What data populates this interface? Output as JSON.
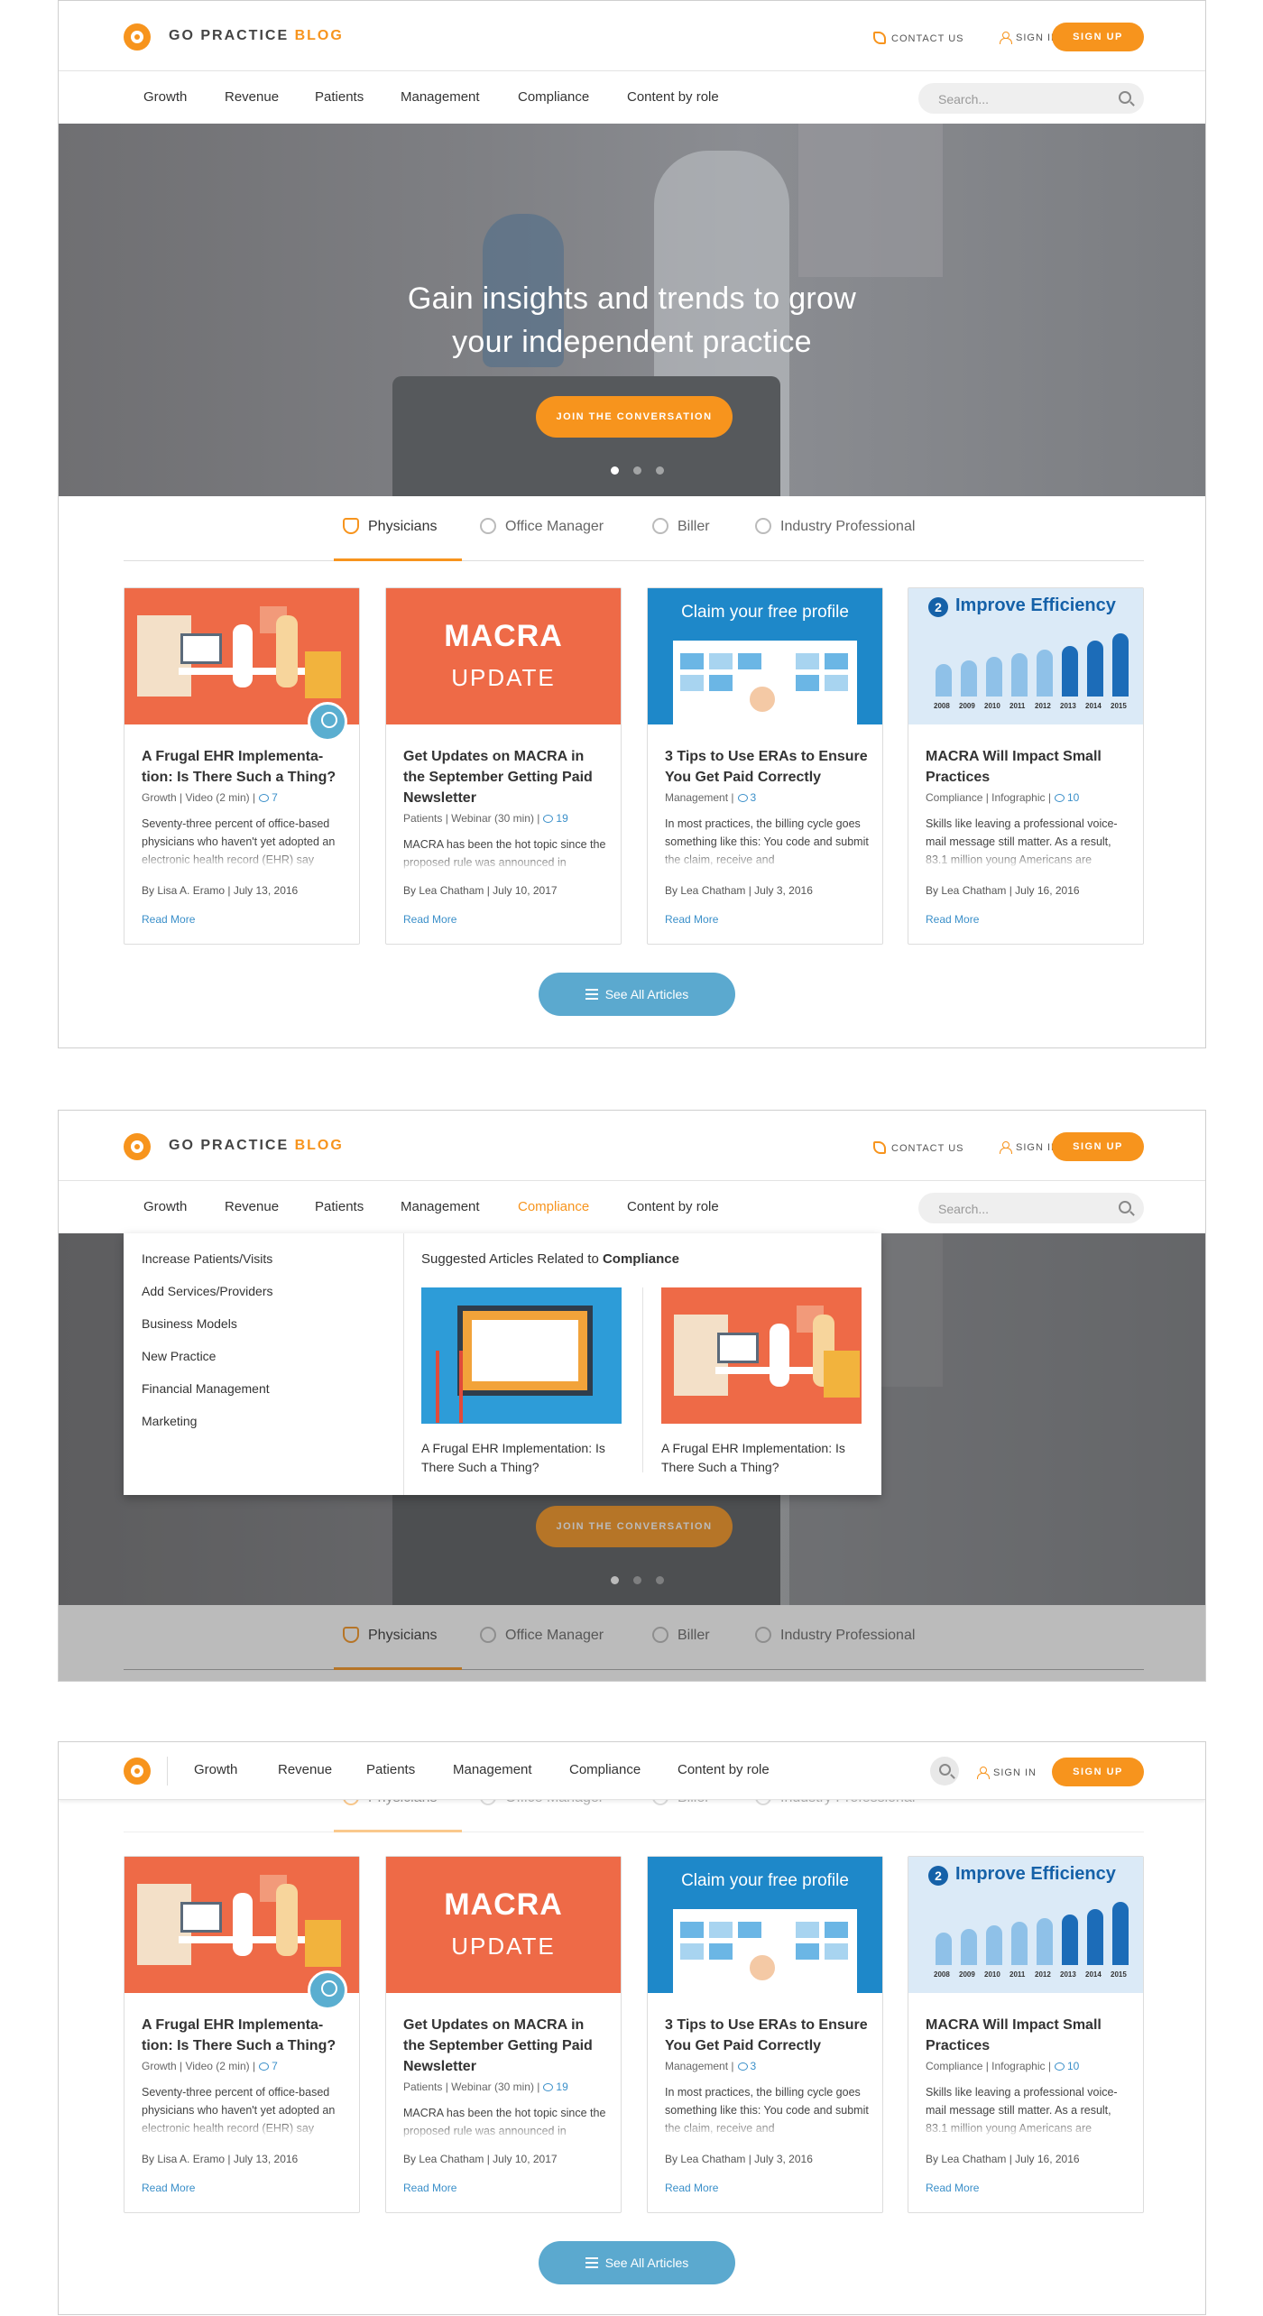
{
  "brand": {
    "name_main": "GO PRACTICE",
    "name_accent": "BLOG",
    "accent_color": "#f7941d",
    "link_color": "#3a8fc9"
  },
  "header": {
    "contact": "CONTACT US",
    "signin": "SIGN IN",
    "signup": "SIGN UP"
  },
  "nav": {
    "items": [
      "Growth",
      "Revenue",
      "Patients",
      "Management",
      "Compliance",
      "Content by role"
    ],
    "active_in_frame2": "Compliance"
  },
  "search": {
    "placeholder": "Search..."
  },
  "hero": {
    "title_line1": "Gain insights and trends to grow",
    "title_line2": "your independent practice",
    "cta": "JOIN THE CONVERSATION",
    "slide_count": 3,
    "active_slide": 1
  },
  "roles": {
    "tabs": [
      "Physicians",
      "Office Manager",
      "Biller",
      "Industry Professional"
    ],
    "active": "Physicians"
  },
  "cards": [
    {
      "title": "A Frugal EHR Implementa-tion: Is There Such a Thing?",
      "meta": "Growth | Video (2 min) |",
      "comments": "7",
      "excerpt": "Seventy-three percent of office-based physicians who haven't yet adopted an electronic health record (EHR) say",
      "byline": "By Lisa A. Eramo | July 13, 2016",
      "read_more": "Read More"
    },
    {
      "title": "Get Updates on MACRA in the September Getting Paid Newsletter",
      "meta": "Patients | Webinar (30 min) |",
      "comments": "19",
      "excerpt": "MACRA has been the hot topic since the proposed rule was announced in",
      "byline": "By Lea Chatham | July 10, 2017",
      "read_more": "Read More",
      "thumb_line1": "MACRA",
      "thumb_line2": "UPDATE"
    },
    {
      "title": "3 Tips to Use ERAs to Ensure You Get Paid Correctly",
      "meta": "Management |",
      "comments": "3",
      "excerpt": "In most practices, the billing cycle goes something like this: You code and submit the claim, receive and",
      "byline": "By Lea Chatham | July 3, 2016",
      "read_more": "Read More",
      "thumb_title": "Claim your free profile"
    },
    {
      "title": "MACRA Will Impact Small Practices",
      "meta": "Compliance | Infographic |",
      "comments": "10",
      "excerpt": "Skills like leaving a professional voice-mail message still matter. As a result, 83.1 million young Americans are",
      "byline": "By Lea Chatham | July 16, 2016",
      "read_more": "Read More",
      "thumb_num": "2",
      "thumb_title": "Improve Efficiency",
      "thumb_years": [
        "2008",
        "2009",
        "2010",
        "2011",
        "2012",
        "2013",
        "2014",
        "2015"
      ]
    }
  ],
  "see_all": "See All Articles",
  "dropdown": {
    "links": [
      "Increase Patients/Visits",
      "Add Services/Providers",
      "Business Models",
      "New Practice",
      "Financial Management",
      "Marketing"
    ],
    "heading_prefix": "Suggested Articles Related to",
    "heading_topic": "Compliance",
    "articles": [
      {
        "title": "A Frugal EHR Implementation: Is There Such a Thing?"
      },
      {
        "title": "A Frugal EHR Implementation: Is There Such a Thing?"
      }
    ]
  }
}
